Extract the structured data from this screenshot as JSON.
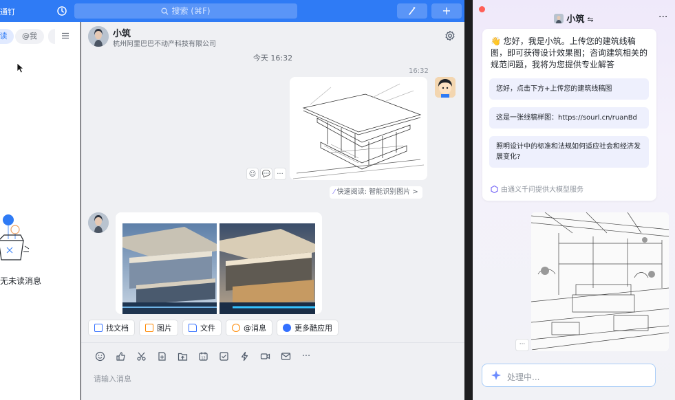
{
  "topbar": {
    "title_fragment": "通钉",
    "search_placeholder": "搜索 (⌘F)",
    "plus_label": "+"
  },
  "left_panel": {
    "chip_all": "读",
    "chip_at": "@我",
    "empty_text": "无未读消息"
  },
  "chat": {
    "name": "小筑",
    "company": "杭州阿里巴巴不动产科技有限公司",
    "time_center": "今天 16:32",
    "time_right": "16:32",
    "quick_read": "快速阅读: 智能识别图片 >",
    "apps": [
      {
        "label": "找文档",
        "icon": "find-doc-icon",
        "color": "#3370ff"
      },
      {
        "label": "图片",
        "icon": "image-icon",
        "color": "#ff8800"
      },
      {
        "label": "文件",
        "icon": "file-icon",
        "color": "#3370ff"
      },
      {
        "label": "@消息",
        "icon": "at-icon",
        "color": "#ff8800"
      },
      {
        "label": "更多酷应用",
        "icon": "cool-apps-icon",
        "color": "#3370ff"
      }
    ],
    "input_placeholder": "请输入消息"
  },
  "ai_panel": {
    "title": "小筑",
    "greeting": "👋 您好，我是小筑。上传您的建筑线稿图，即可获得设计效果图；咨询建筑相关的规范问题，我将为您提供专业解答",
    "suggestions": [
      "您好，点击下方+上传您的建筑线稿图",
      "这是一张线稿样图：https://sourl.cn/ruanBd",
      "照明设计中的标准和法规如何适应社会和经济发展变化?"
    ],
    "footer": "由通义千问提供大模型服务",
    "input_placeholder": "处理中..."
  },
  "colors": {
    "brand_blue": "#2f7bf5",
    "ai_accent": "#7b6cf6"
  }
}
